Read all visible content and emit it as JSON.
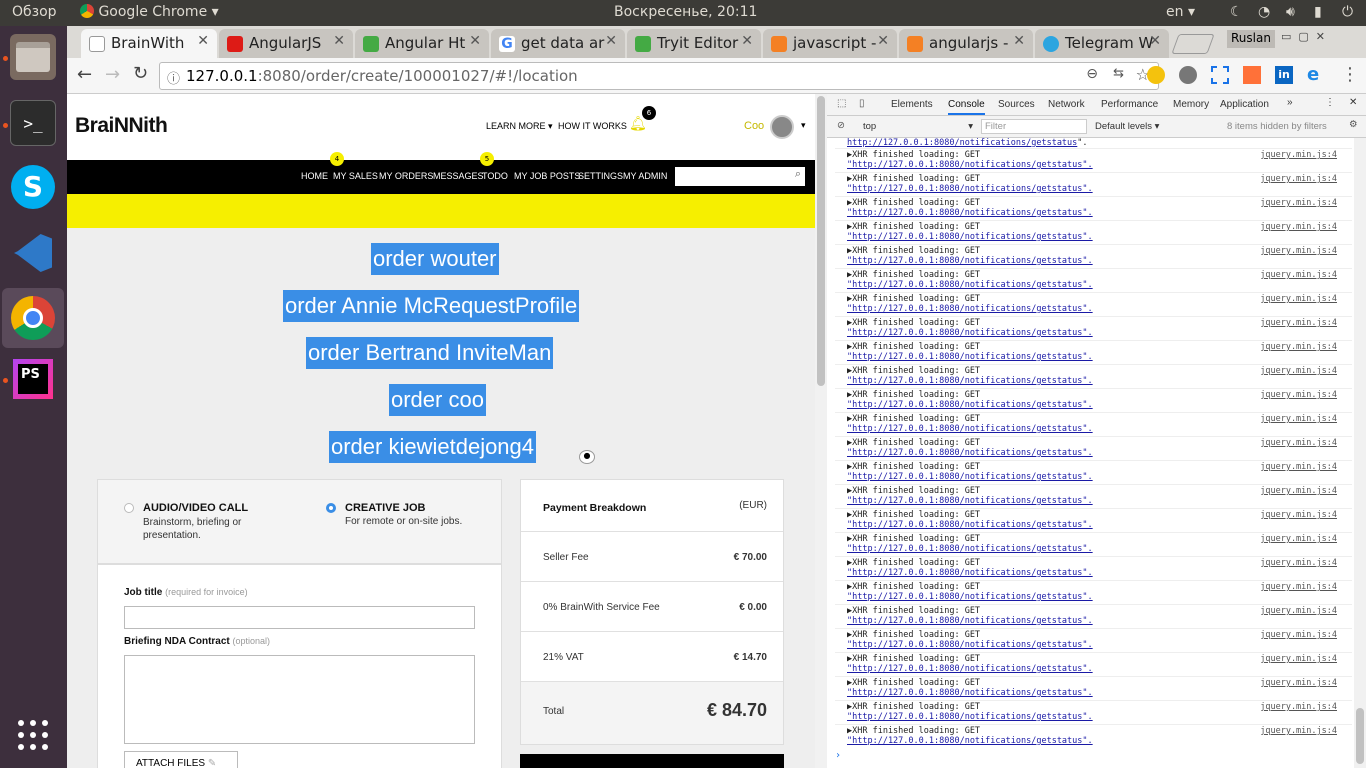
{
  "system": {
    "overview": "Обзор",
    "app_name": "Google Chrome",
    "clock": "Воскресенье, 20:11",
    "lang": "en",
    "user": "Ruslan"
  },
  "dock": {
    "items": [
      "files",
      "terminal",
      "skype",
      "vscode",
      "chrome",
      "phpstorm",
      "apps-grid"
    ]
  },
  "tabs": [
    {
      "label": "BrainWith",
      "active": true,
      "color": "#ffffff"
    },
    {
      "label": "AngularJS",
      "active": false,
      "color": "#dd1b16"
    },
    {
      "label": "Angular Ht",
      "active": false,
      "color": "#44aa44"
    },
    {
      "label": "get data ar",
      "active": false,
      "color": "#4285f4"
    },
    {
      "label": "Tryit Editor",
      "active": false,
      "color": "#44aa44"
    },
    {
      "label": "javascript -",
      "active": false,
      "color": "#f48024"
    },
    {
      "label": "angularjs -",
      "active": false,
      "color": "#f48024"
    },
    {
      "label": "Telegram W",
      "active": false,
      "color": "#2ca5e0"
    }
  ],
  "address": {
    "host": "127.0.0.1",
    "path": ":8080/order/create/100001027/#!/location"
  },
  "site": {
    "logo": "BraiNNith",
    "learn_more": "LEARN MORE",
    "how_it_works": "HOW IT WORKS",
    "notif_count": "6",
    "user_name": "Coo",
    "nav": [
      "HOME",
      "MY SALES",
      "MY ORDERS",
      "MESSAGES",
      "TODO",
      "MY JOB POSTS",
      "SETTINGS",
      "MY ADMIN"
    ],
    "sales_badge": "4",
    "todo_badge": "5"
  },
  "orders": [
    "order wouter",
    "order Annie McRequestProfile",
    "order Bertrand InviteMan",
    "order coo",
    "order kiewietdejong4"
  ],
  "job_types": {
    "audio_title": "AUDIO/VIDEO CALL",
    "audio_desc": "Brainstorm, briefing or presentation.",
    "creative_title": "CREATIVE JOB",
    "creative_desc": "For remote or on-site jobs."
  },
  "form": {
    "job_title_label": "Job title",
    "job_title_hint": "(required for invoice)",
    "nda_label": "Briefing NDA Contract",
    "nda_hint": "(optional)",
    "attach": "ATTACH FILES"
  },
  "payment": {
    "title": "Payment Breakdown",
    "currency": "(EUR)",
    "rows": [
      {
        "label": "Seller Fee",
        "value": "€ 70.00"
      },
      {
        "label": "0% BrainWith Service Fee",
        "value": "€ 0.00"
      },
      {
        "label": "21% VAT",
        "value": "€ 14.70"
      }
    ],
    "total_label": "Total",
    "total_value": "€ 84.70"
  },
  "devtools": {
    "tabs": [
      "Elements",
      "Console",
      "Sources",
      "Network",
      "Performance",
      "Memory",
      "Application"
    ],
    "context": "top",
    "filter_placeholder": "Filter",
    "levels": "Default levels",
    "hidden": "8 items hidden by filters",
    "first_url": "http://127.0.0.1:8080/notifications/getstatus",
    "log_text": "▶XHR finished loading: GET",
    "log_url": "\"http://127.0.0.1:8080/notifications/getstatus\".",
    "log_src": "jquery.min.js:4",
    "log_count": 25
  }
}
